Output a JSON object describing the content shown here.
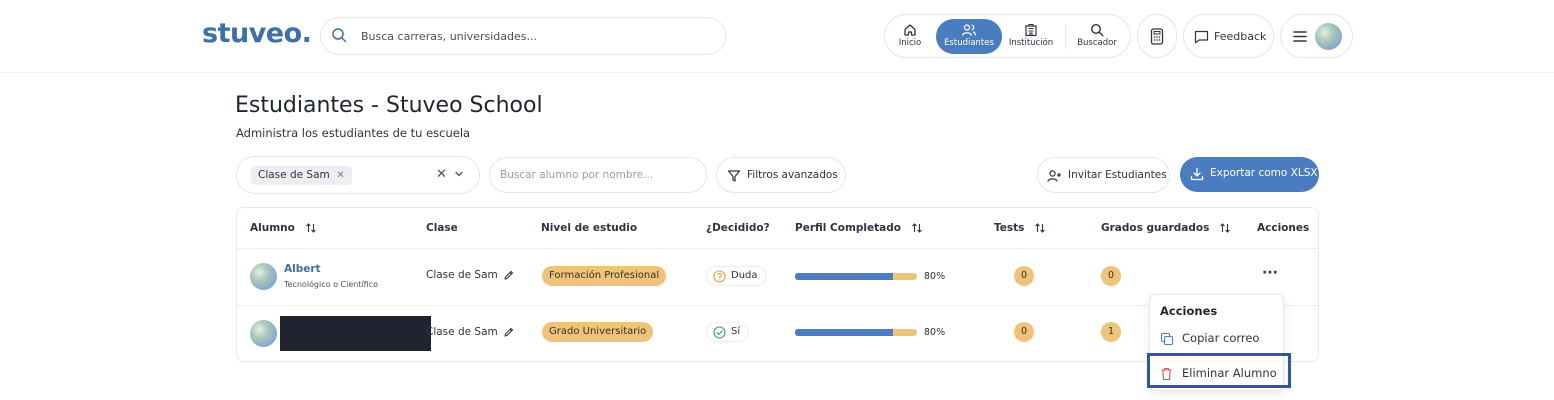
{
  "header": {
    "logo": "stuveo.",
    "search_placeholder": "Busca carreras, universidades...",
    "nav": [
      {
        "label": "Inicio",
        "icon": "home-icon",
        "active": false
      },
      {
        "label": "Estudiantes",
        "icon": "users-icon",
        "active": true
      },
      {
        "label": "Institución",
        "icon": "building-icon",
        "active": false
      },
      {
        "label": "Buscador",
        "icon": "search-icon",
        "active": false
      }
    ],
    "calculator_icon": "calculator-icon",
    "feedback_label": "Feedback",
    "menu_icon": "hamburger-icon"
  },
  "page": {
    "title": "Estudiantes - Stuveo School",
    "subtitle": "Administra los estudiantes de tu escuela"
  },
  "toolbar": {
    "class_chip": "Clase de Sam",
    "name_search_placeholder": "Buscar alumno por nombre...",
    "filters_label": "Filtros avanzados",
    "invite_label": "Invitar Estudiantes",
    "export_label": "Exportar como XLSX"
  },
  "table": {
    "headers": {
      "alumno": "Alumno",
      "clase": "Clase",
      "nivel": "Nivel de estudio",
      "decidido": "¿Decidido?",
      "perfil": "Perfil Completado",
      "tests": "Tests",
      "grados": "Grados guardados",
      "acciones": "Acciones"
    },
    "rows": [
      {
        "name": "Albert",
        "subtitle": "Tecnológico o Científico",
        "class": "Clase de Sam",
        "level": "Formación Profesional",
        "decided": "Duda",
        "decided_state": "question",
        "profile_fraction": 0.8,
        "profile_pct": "80%",
        "tests": "0",
        "grados": "0"
      },
      {
        "name": "",
        "subtitle": "",
        "class": "Clase de Sam",
        "level": "Grado Universitario",
        "decided": "Sí",
        "decided_state": "check",
        "profile_fraction": 0.8,
        "profile_pct": "80%",
        "tests": "0",
        "grados": "1"
      }
    ]
  },
  "actions_menu": {
    "title": "Acciones",
    "items": [
      {
        "label": "Copiar correo",
        "icon": "copy-icon"
      },
      {
        "label": "Eliminar Alumno",
        "icon": "trash-icon"
      }
    ]
  },
  "colors": {
    "accent": "#4a7cc2",
    "brand": "#3f6fa8",
    "badge": "#f0c478",
    "highlight": "#2f55a8",
    "danger": "#d9534f"
  }
}
